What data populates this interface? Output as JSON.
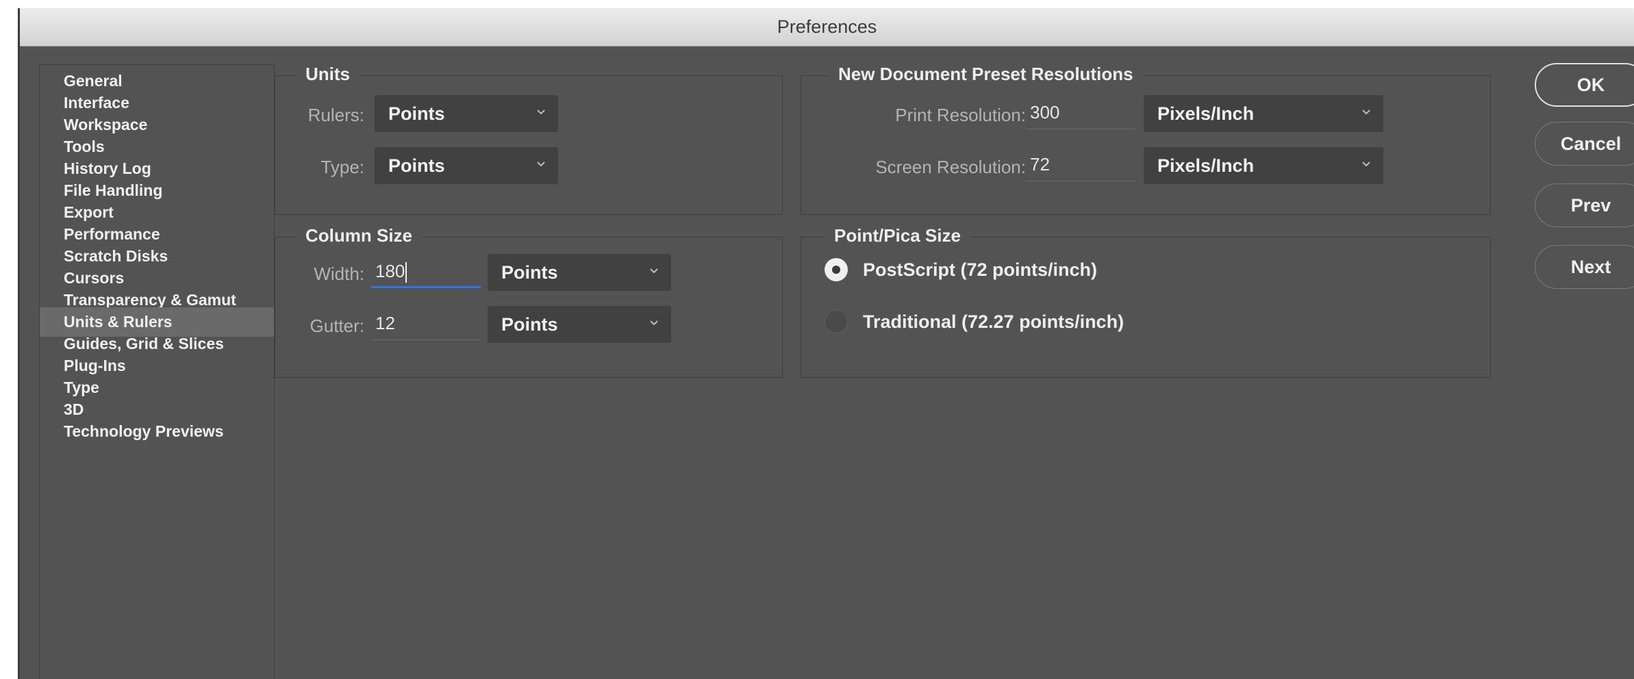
{
  "window": {
    "title": "Preferences"
  },
  "sidebar": {
    "items": [
      {
        "label": "General",
        "selected": false
      },
      {
        "label": "Interface",
        "selected": false
      },
      {
        "label": "Workspace",
        "selected": false
      },
      {
        "label": "Tools",
        "selected": false
      },
      {
        "label": "History Log",
        "selected": false
      },
      {
        "label": "File Handling",
        "selected": false
      },
      {
        "label": "Export",
        "selected": false
      },
      {
        "label": "Performance",
        "selected": false
      },
      {
        "label": "Scratch Disks",
        "selected": false
      },
      {
        "label": "Cursors",
        "selected": false
      },
      {
        "label": "Transparency & Gamut",
        "selected": false
      },
      {
        "label": "Units & Rulers",
        "selected": true
      },
      {
        "label": "Guides, Grid & Slices",
        "selected": false
      },
      {
        "label": "Plug-Ins",
        "selected": false
      },
      {
        "label": "Type",
        "selected": false
      },
      {
        "label": "3D",
        "selected": false
      },
      {
        "label": "Technology Previews",
        "selected": false
      }
    ]
  },
  "units": {
    "legend": "Units",
    "rulers_label": "Rulers:",
    "rulers_value": "Points",
    "type_label": "Type:",
    "type_value": "Points"
  },
  "column_size": {
    "legend": "Column Size",
    "width_label": "Width:",
    "width_value": "180",
    "width_unit": "Points",
    "gutter_label": "Gutter:",
    "gutter_value": "12",
    "gutter_unit": "Points"
  },
  "resolutions": {
    "legend": "New Document Preset Resolutions",
    "print_label": "Print Resolution:",
    "print_value": "300",
    "print_unit": "Pixels/Inch",
    "screen_label": "Screen Resolution:",
    "screen_value": "72",
    "screen_unit": "Pixels/Inch"
  },
  "point_pica": {
    "legend": "Point/Pica Size",
    "options": [
      {
        "label": "PostScript (72 points/inch)",
        "checked": true
      },
      {
        "label": "Traditional (72.27 points/inch)",
        "checked": false
      }
    ]
  },
  "buttons": {
    "ok": "OK",
    "cancel": "Cancel",
    "prev": "Prev",
    "next": "Next"
  },
  "icons": {
    "chevron": "chevron-down-icon",
    "radio": "radio-button-icon"
  },
  "colors": {
    "panel": "#535353",
    "dropdown": "#414141",
    "focus": "#3f74c8",
    "selected_row": "#6a6a6a"
  }
}
